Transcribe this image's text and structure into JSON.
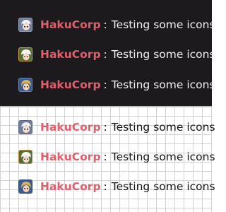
{
  "colors": {
    "dark_background": "#1c1a1c",
    "light_background": "#ffffff",
    "name_color": "#df5f6c"
  },
  "dark_panel": {
    "messages": [
      {
        "avatar_icon": "white-hair-character-avatar-icon",
        "username": "HakuCorp",
        "separator": ":",
        "text": "Testing some icons"
      },
      {
        "avatar_icon": "white-hair-character-avatar-icon",
        "username": "HakuCorp",
        "separator": ":",
        "text": "Testing some icons"
      },
      {
        "avatar_icon": "blonde-character-avatar-icon",
        "username": "HakuCorp",
        "separator": ":",
        "text": "Testing some icons"
      }
    ]
  },
  "light_panel": {
    "messages": [
      {
        "avatar_icon": "white-hair-character-avatar-icon",
        "username": "HakuCorp",
        "separator": ":",
        "text": "Testing some icons"
      },
      {
        "avatar_icon": "white-hair-character-avatar-icon",
        "username": "HakuCorp",
        "separator": ":",
        "text": "Testing some icons"
      },
      {
        "avatar_icon": "blonde-character-avatar-icon",
        "username": "HakuCorp",
        "separator": ":",
        "text": "Testing some icons"
      }
    ]
  }
}
